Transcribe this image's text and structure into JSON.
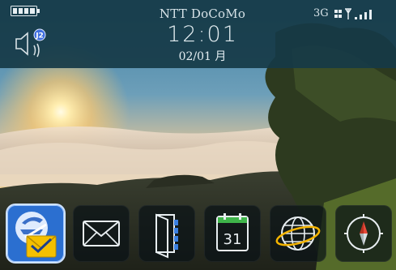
{
  "status_bar": {
    "carrier": "NTT DoCoMo",
    "time": "12:01",
    "date": "02/01 月",
    "network": "3G",
    "battery_level": 1.0,
    "signal_bars": 4
  },
  "wallpaper": {
    "description_colors": {
      "sky_top": "#4b86a9",
      "horizon_glow": "#ffd27a",
      "fog": "#e8d6c8",
      "hills": "#2f3426"
    }
  },
  "dock": {
    "items": [
      {
        "icon": "email-setup-icon",
        "selected": true
      },
      {
        "icon": "messages-icon",
        "selected": false
      },
      {
        "icon": "contacts-book-icon",
        "selected": false
      },
      {
        "icon": "calendar-icon",
        "label": "31",
        "selected": false
      },
      {
        "icon": "browser-globe-icon",
        "selected": false
      },
      {
        "icon": "compass-maps-icon",
        "selected": false
      }
    ]
  },
  "colors": {
    "status_bg": "#163a46",
    "accent_blue": "#2b6fd0",
    "envelope_yellow": "#f4c000"
  }
}
